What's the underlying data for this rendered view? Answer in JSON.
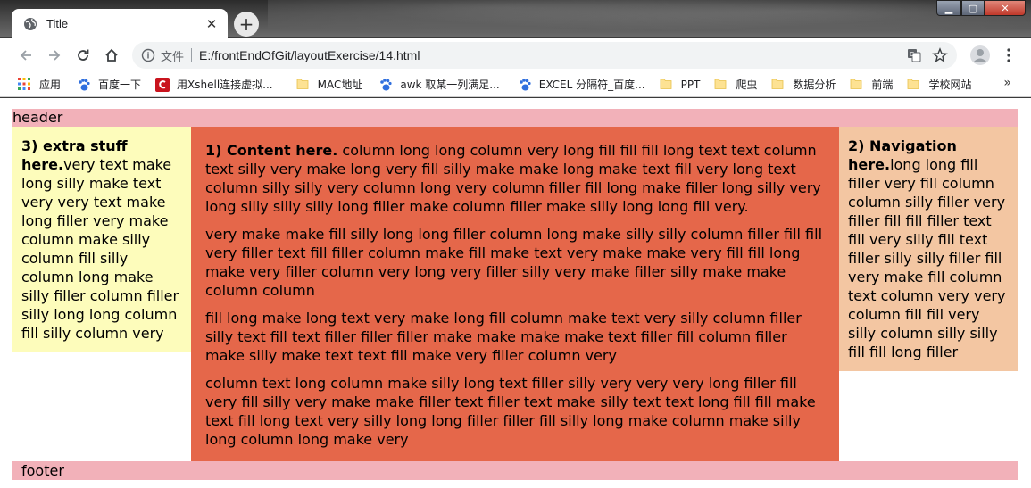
{
  "browser": {
    "tab_title": "Title",
    "tab_close": "✕",
    "new_tab": "+",
    "window_controls": {
      "minimize": "▁",
      "maximize": "▢",
      "close": "✕"
    },
    "file_label": "文件",
    "url": "E:/frontEndOfGit/layoutExercise/14.html",
    "icons": [
      "globe-icon",
      "back-arrow-icon",
      "forward-arrow-icon",
      "reload-icon",
      "home-icon",
      "info-icon",
      "translate-icon",
      "star-icon",
      "profile-icon",
      "menu-dots-icon"
    ]
  },
  "bookmarks": [
    {
      "label": "应用",
      "icon": "apps-grid-icon"
    },
    {
      "label": "百度一下",
      "icon": "baidu-paw-icon"
    },
    {
      "label": "用Xshell连接虚拟...",
      "icon": "csdn-icon"
    },
    {
      "label": "MAC地址",
      "icon": "folder-icon"
    },
    {
      "label": "awk 取某一列满足...",
      "icon": "baidu-paw-icon"
    },
    {
      "label": "EXCEL 分隔符_百度...",
      "icon": "baidu-paw-icon"
    },
    {
      "label": "PPT",
      "icon": "folder-icon"
    },
    {
      "label": "爬虫",
      "icon": "folder-icon"
    },
    {
      "label": "数据分析",
      "icon": "folder-icon"
    },
    {
      "label": "前端",
      "icon": "folder-icon"
    },
    {
      "label": "学校网站",
      "icon": "folder-icon"
    }
  ],
  "bookmarks_more": "»",
  "page": {
    "header": "header",
    "left": {
      "heading": "3) extra stuff here.",
      "text": "very text make long silly make text very very text make long filler very make column make silly column fill silly column long make silly filler column filler silly long long column fill silly column very"
    },
    "main": {
      "heading": "1) Content here.",
      "para1": " column long long column very long fill fill fill long text text column text silly very make long very fill silly make make long make text fill very long text column silly silly very column long very column filler fill long make filler long silly very long silly silly silly long filler make column filler make silly long long fill very.",
      "para2": "very make make fill silly long long filler column long make silly silly column filler fill fill very filler text fill filler column make fill make text very make make very fill fill long make very filler column very long very filler silly very make filler silly make make column column",
      "para3": "fill long make long text very make long fill column make text very silly column filler silly text fill text filler filler filler make make make make text filler fill column filler make silly make text text fill make very filler column very",
      "para4": "column text long column make silly long text filler silly very very very long filler fill very fill silly very make make filler text filler text make silly text text long fill fill make text fill long text very silly long long filler filler fill silly long make column make silly long column long make very"
    },
    "right": {
      "heading": "2) Navigation here.",
      "text": "long long fill filler very fill column column silly filler very filler fill fill filler text fill very silly fill text filler silly silly filler fill very make fill column text column very very column fill fill very silly column silly silly fill fill long filler"
    },
    "footer": "footer"
  },
  "colors": {
    "header_footer": "#f2b1b9",
    "left_column": "#fdfcbb",
    "main_column": "#e5674a",
    "right_column": "#f3c6a2"
  }
}
